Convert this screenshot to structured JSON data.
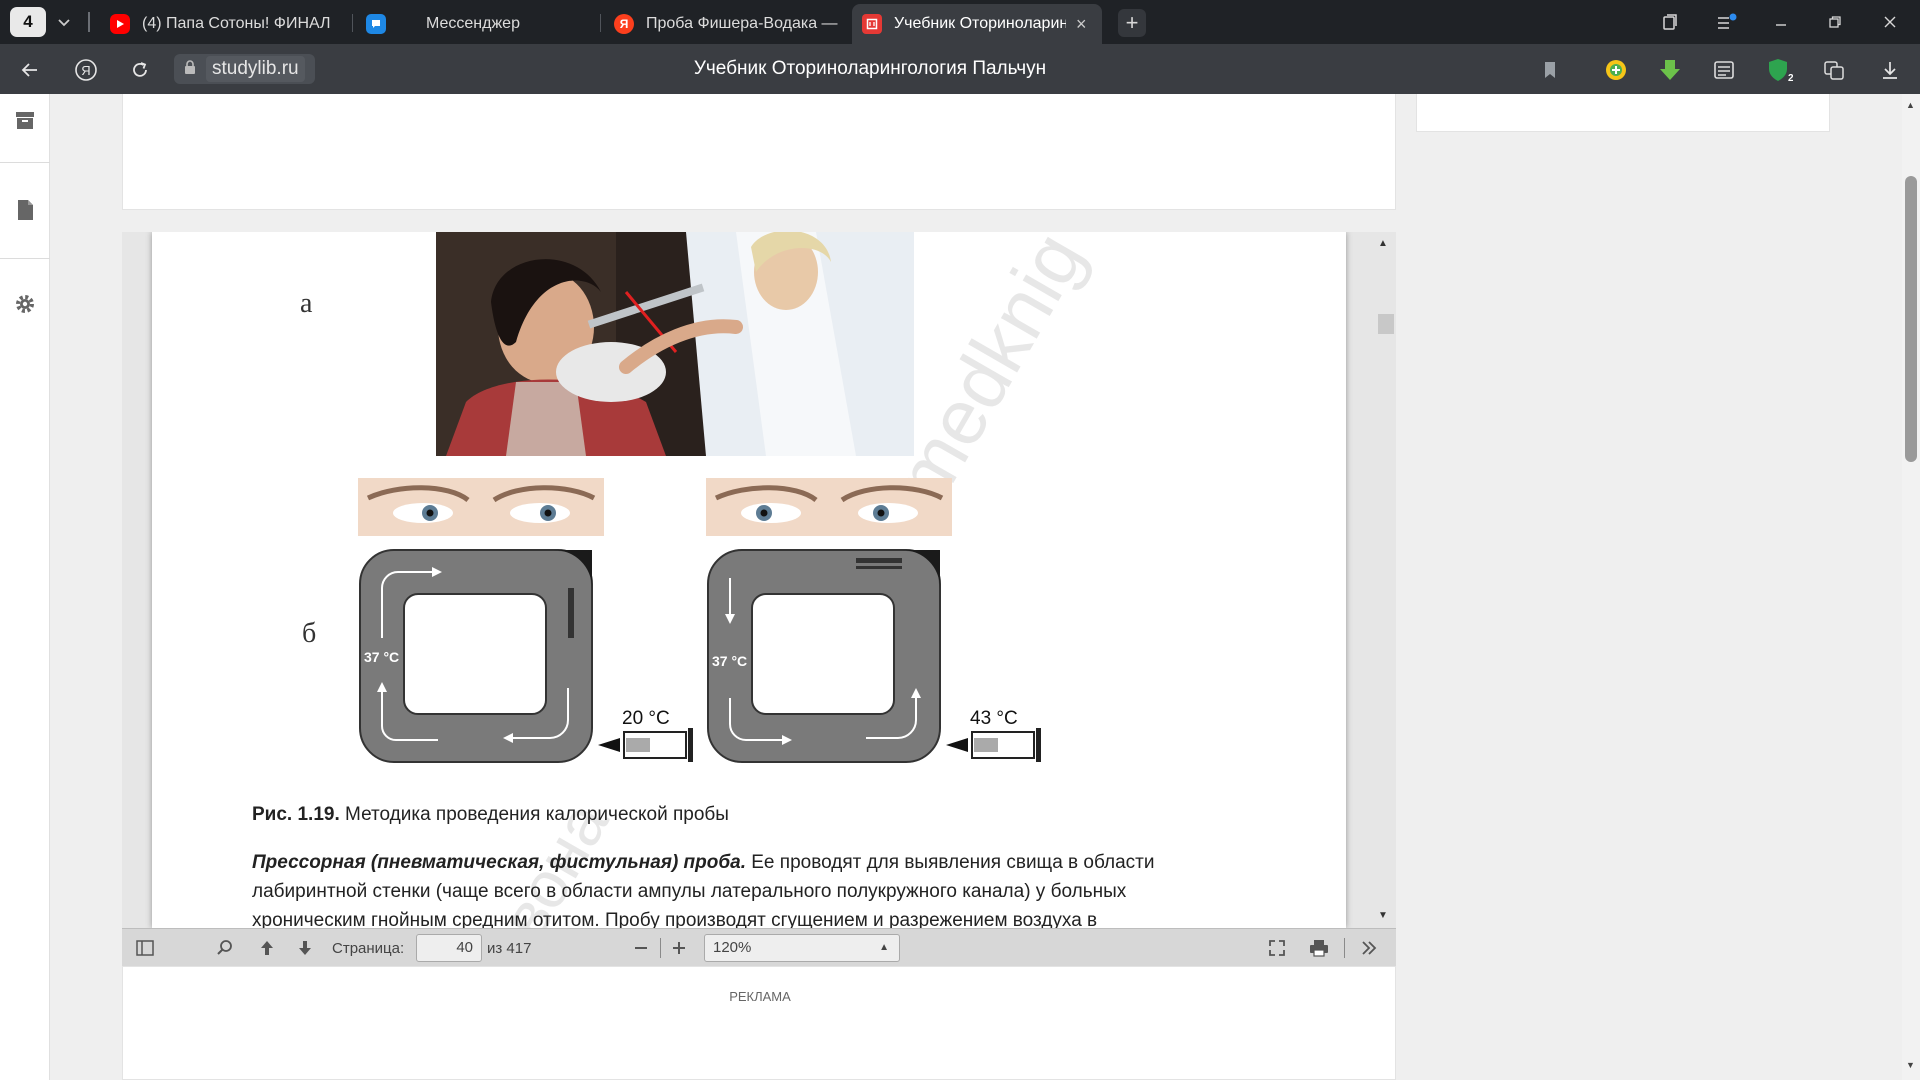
{
  "browser": {
    "tab_count": "4",
    "tabs": [
      {
        "label": "(4) Папа Сотоны! ФИНАЛ",
        "favicon": "youtube"
      },
      {
        "label": "",
        "favicon": "messenger"
      },
      {
        "label": "Мессенджер",
        "favicon": ""
      },
      {
        "label": "Проба Фишера-Водака —",
        "favicon": "yandex"
      },
      {
        "label": "Учебник Оториноларинг",
        "favicon": "studylib",
        "active": true
      }
    ],
    "domain": "studylib.ru",
    "page_title": "Учебник Оториноларингология Пальчун",
    "extension_badge": "2"
  },
  "document": {
    "label_a": "а",
    "label_b": "б",
    "watermark": "medknig",
    "watermark_bottom": "вона",
    "left_temp": "37 °C",
    "left_syringe_temp": "20 °C",
    "right_temp": "37 °C",
    "right_syringe_temp": "43 °C",
    "caption_bold": "Рис. 1.19.",
    "caption_text": " Методика проведения калорической пробы",
    "paragraph_lead": "Прессорная (пневматическая, фистульная) проба.",
    "paragraph_text": " Ее проводят для выявления свища в области лабиринтной стенки (чаще всего в области ампулы латерального полукружного канала) у больных хроническим гнойным средним отитом. Пробу производят сгущением и разрежением воздуха в"
  },
  "pdf_toolbar": {
    "page_label": "Страница:",
    "page_value": "40",
    "page_total": "из 417",
    "zoom": "120%"
  },
  "ad": {
    "label": "РЕКЛАМА"
  },
  "colors": {
    "youtube": "#ff0000",
    "messenger": "#1e88e5",
    "yandex": "#fc3f1d",
    "studylib": "#e53935",
    "diagram_gray": "#7a7a7a"
  }
}
